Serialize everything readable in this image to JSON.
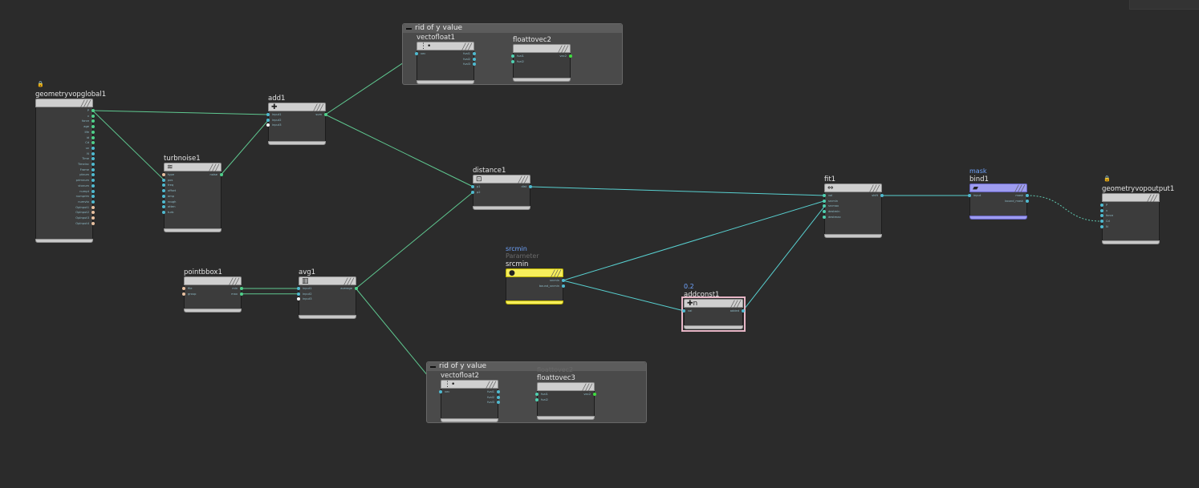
{
  "colors": {
    "background": "#2b2b2b",
    "wire": "#5fc8a8",
    "wire_cyan": "#58d0d0"
  },
  "netboxes": [
    {
      "title": "rid of y value"
    },
    {
      "title": "rid of y value"
    }
  ],
  "nodes": {
    "geometryvopglobal1": {
      "name": "geometryvopglobal1",
      "outputs": [
        "P",
        "v",
        "force",
        "age",
        "life",
        "id",
        "Cd",
        "uv",
        "N",
        "Time",
        "Timeinc",
        "Frame",
        "ptnum",
        "primnum",
        "vtxnum",
        "numpt",
        "numprim",
        "numvtx",
        "OpInput1",
        "OpInput2",
        "OpInput3",
        "OpInput4"
      ]
    },
    "turbnoise1": {
      "name": "turbnoise1",
      "inputs": [
        "type",
        "pos",
        "freq",
        "offset",
        "amp",
        "rough",
        "atten",
        "turb"
      ],
      "outputs": [
        "noise"
      ]
    },
    "add1": {
      "name": "add1",
      "inputs": [
        "input1",
        "input2",
        "input3"
      ],
      "outputs": [
        "sum"
      ]
    },
    "vectofloat1": {
      "name": "vectofloat1",
      "inputs": [
        "vec"
      ],
      "outputs": [
        "fval1",
        "fval2",
        "fval3"
      ]
    },
    "floattovec2": {
      "name": "floattovec2",
      "inputs": [
        "fval1",
        "fval2"
      ],
      "outputs": [
        "vec2"
      ]
    },
    "distance1": {
      "name": "distance1",
      "inputs": [
        "p1",
        "p2"
      ],
      "outputs": [
        "dist"
      ]
    },
    "pointbbox1": {
      "name": "pointbbox1",
      "inputs": [
        "file",
        "group"
      ],
      "outputs": [
        "min",
        "max"
      ]
    },
    "avg1": {
      "name": "avg1",
      "inputs": [
        "input1",
        "input2",
        "input3"
      ],
      "outputs": [
        "average"
      ]
    },
    "srcmin": {
      "comment": "srcmin",
      "subtitle": "Parameter",
      "name": "srcmin",
      "outputs": [
        "srcmin",
        "bound_srcmin"
      ]
    },
    "addconst1": {
      "comment": "0.2",
      "name": "addconst1",
      "inputs": [
        "val"
      ],
      "outputs": [
        "added"
      ]
    },
    "fit1": {
      "name": "fit1",
      "inputs": [
        "val",
        "srcmin",
        "srcmax",
        "destmin",
        "destmax"
      ],
      "outputs": [
        "shift"
      ]
    },
    "bind1": {
      "comment": "mask",
      "name": "bind1",
      "inputs": [
        "input"
      ],
      "outputs": [
        "mask",
        "bound_mask"
      ]
    },
    "geometryvopoutput1": {
      "name": "geometryvopoutput1",
      "inputs": [
        "P",
        "v",
        "force",
        "Cd",
        "N"
      ]
    },
    "vectofloat2": {
      "name": "vectofloat2",
      "inputs": [
        "vec"
      ],
      "outputs": [
        "fval1",
        "fval2",
        "fval3"
      ]
    },
    "floattovec3": {
      "ghost": "floattovec2",
      "name": "floattovec3",
      "inputs": [
        "fval1",
        "fval2"
      ],
      "outputs": [
        "vec2"
      ]
    }
  }
}
